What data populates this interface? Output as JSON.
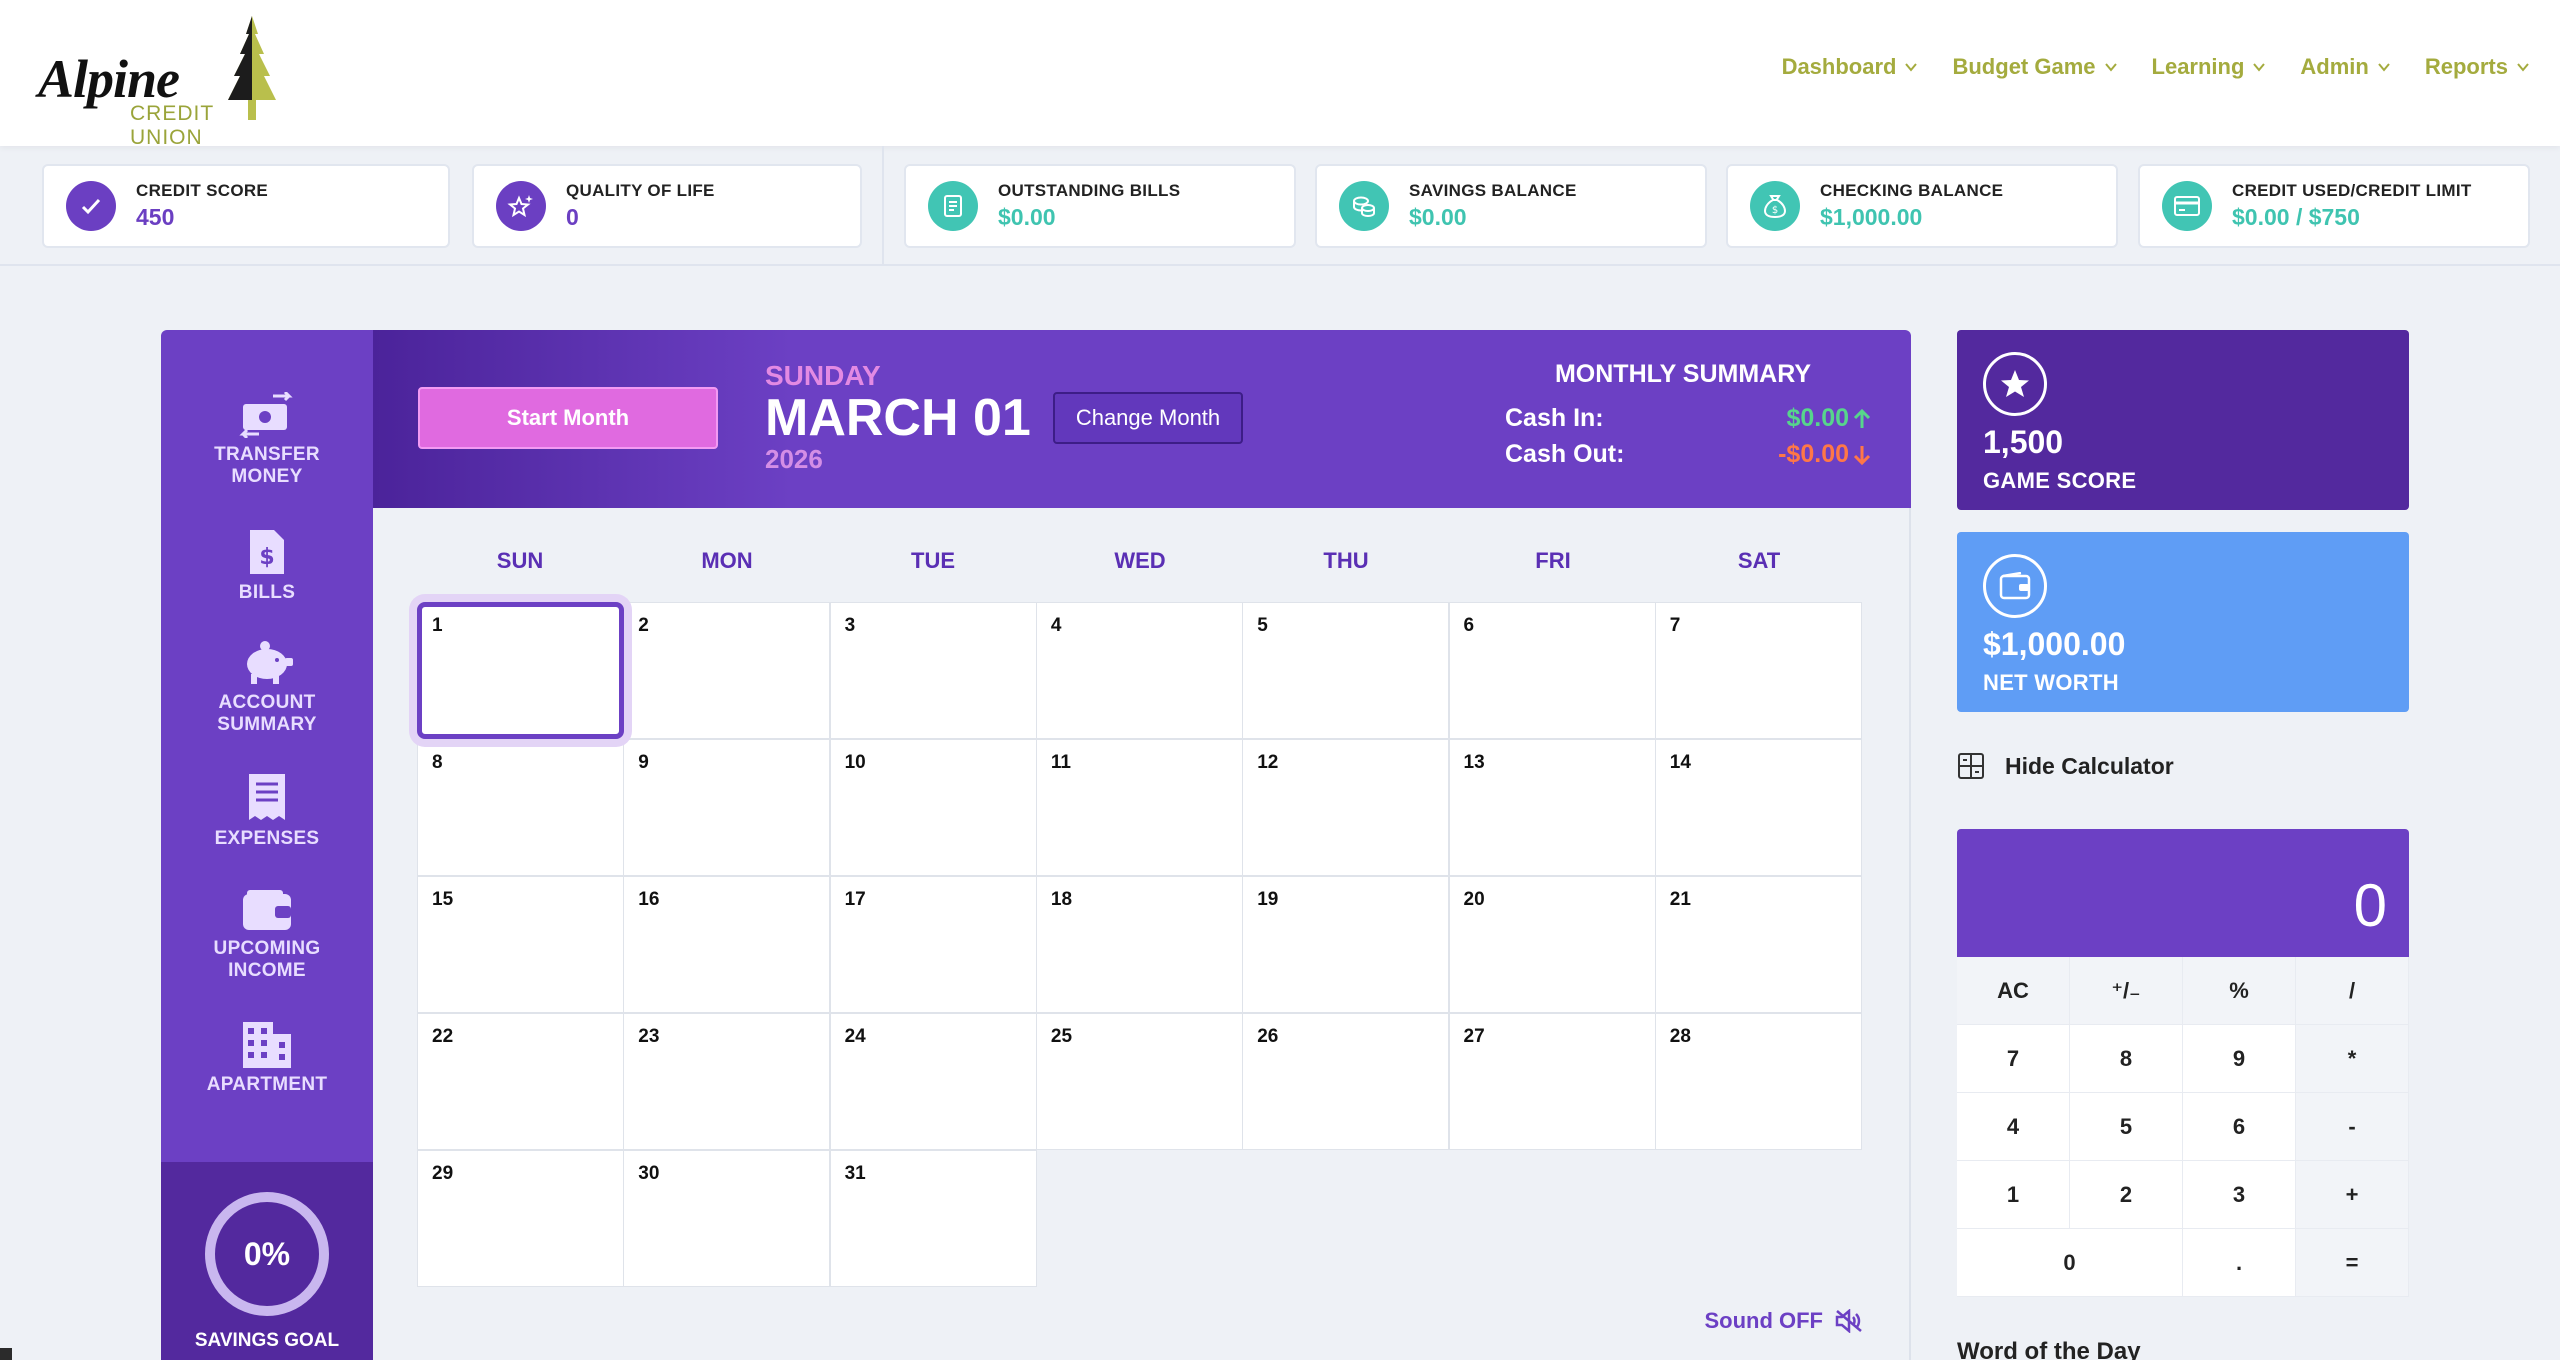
{
  "logo": {
    "word": "Alpine",
    "sub": "CREDIT UNION"
  },
  "nav": [
    {
      "label": "Dashboard"
    },
    {
      "label": "Budget Game"
    },
    {
      "label": "Learning"
    },
    {
      "label": "Admin"
    },
    {
      "label": "Reports"
    }
  ],
  "stats": {
    "credit_score": {
      "label": "CREDIT SCORE",
      "value": "450"
    },
    "quality_of_life": {
      "label": "QUALITY OF LIFE",
      "value": "0"
    },
    "outstanding_bills": {
      "label": "OUTSTANDING BILLS",
      "value": "$0.00"
    },
    "savings_balance": {
      "label": "SAVINGS BALANCE",
      "value": "$0.00"
    },
    "checking_balance": {
      "label": "CHECKING BALANCE",
      "value": "$1,000.00"
    },
    "credit_used": {
      "label": "CREDIT USED/CREDIT LIMIT",
      "value": "$0.00 / $750"
    }
  },
  "sidebar": {
    "items": [
      {
        "label_1": "TRANSFER",
        "label_2": "MONEY"
      },
      {
        "label_1": "BILLS"
      },
      {
        "label_1": "ACCOUNT",
        "label_2": "SUMMARY"
      },
      {
        "label_1": "EXPENSES"
      },
      {
        "label_1": "UPCOMING",
        "label_2": "INCOME"
      },
      {
        "label_1": "APARTMENT"
      }
    ],
    "savings_goal": {
      "percent": "0%",
      "label": "SAVINGS GOAL"
    }
  },
  "calendar_header": {
    "start_button": "Start Month",
    "day_name": "SUNDAY",
    "date": "MARCH 01",
    "year": "2026",
    "change_button": "Change Month",
    "summary_title": "MONTHLY SUMMARY",
    "cash_in_label": "Cash In:",
    "cash_in_value": "$0.00",
    "cash_out_label": "Cash Out:",
    "cash_out_value": "-$0.00"
  },
  "calendar": {
    "weekdays": [
      "SUN",
      "MON",
      "TUE",
      "WED",
      "THU",
      "FRI",
      "SAT"
    ],
    "days": [
      "1",
      "2",
      "3",
      "4",
      "5",
      "6",
      "7",
      "8",
      "9",
      "10",
      "11",
      "12",
      "13",
      "14",
      "15",
      "16",
      "17",
      "18",
      "19",
      "20",
      "21",
      "22",
      "23",
      "24",
      "25",
      "26",
      "27",
      "28",
      "29",
      "30",
      "31"
    ],
    "selected_day": "1"
  },
  "sound": {
    "label": "Sound OFF"
  },
  "game_score": {
    "value": "1,500",
    "label": "GAME SCORE"
  },
  "net_worth": {
    "value": "$1,000.00",
    "label": "NET WORTH"
  },
  "calculator": {
    "toggle_label": "Hide Calculator",
    "display": "0",
    "keys": [
      "AC",
      "⁺/₋",
      "%",
      "/",
      "7",
      "8",
      "9",
      "*",
      "4",
      "5",
      "6",
      "-",
      "1",
      "2",
      "3",
      "+",
      "0",
      ".",
      "="
    ]
  },
  "word_of_day": {
    "title": "Word of the Day"
  },
  "colors": {
    "primary_purple": "#6c40c4",
    "dark_purple": "#53299e",
    "accent_pink": "#e06ae0",
    "teal": "#41c5b4",
    "olive_nav": "#a4ab3e",
    "net_worth_blue": "#5f9df5",
    "cash_in_green": "#57d58c",
    "cash_out_red": "#ff7747"
  }
}
